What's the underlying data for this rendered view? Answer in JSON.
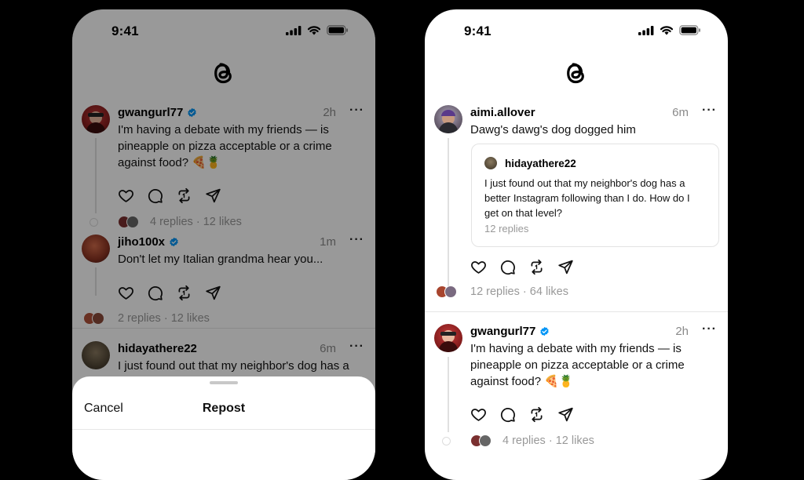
{
  "left_phone": {
    "time": "9:41",
    "posts": [
      {
        "username": "gwangurl77",
        "verified": true,
        "time": "2h",
        "text": "I'm having a debate with my friends — is pineapple on pizza acceptable or a crime against food? 🍕🍍",
        "replies": "4 replies",
        "likes": "12 likes"
      },
      {
        "username": "jiho100x",
        "verified": true,
        "time": "1m",
        "text": "Don't let my Italian grandma hear you...",
        "replies": "2 replies",
        "likes": "12 likes"
      },
      {
        "username": "hidayathere22",
        "verified": false,
        "time": "6m",
        "text": "I just found out that my neighbor's dog has a"
      }
    ],
    "sheet": {
      "cancel_label": "Cancel",
      "title": "Repost"
    }
  },
  "right_phone": {
    "time": "9:41",
    "posts": [
      {
        "username": "aimi.allover",
        "time": "6m",
        "text": "Dawg's dawg's dog dogged him",
        "quote": {
          "username": "hidayathere22",
          "text": "I just found out that my neighbor's dog has a better Instagram following than I do. How do I get on that level?",
          "replies": "12 replies"
        },
        "replies": "12 replies",
        "likes": "64 likes"
      },
      {
        "username": "gwangurl77",
        "verified": true,
        "time": "2h",
        "text": "I'm having a debate with my friends — is pineapple on pizza acceptable or a crime against food? 🍕🍍",
        "replies": "4 replies",
        "likes": "12 likes"
      }
    ]
  },
  "separator": "·",
  "icons": {
    "logo": "threads-logo-icon",
    "like": "heart-icon",
    "reply": "comment-icon",
    "repost": "repost-icon",
    "share": "send-icon",
    "more": "more-dots-icon",
    "verified": "verified-badge-icon"
  },
  "colors": {
    "verified": "#0095f6",
    "muted_text": "#999999",
    "background": "#000000"
  }
}
